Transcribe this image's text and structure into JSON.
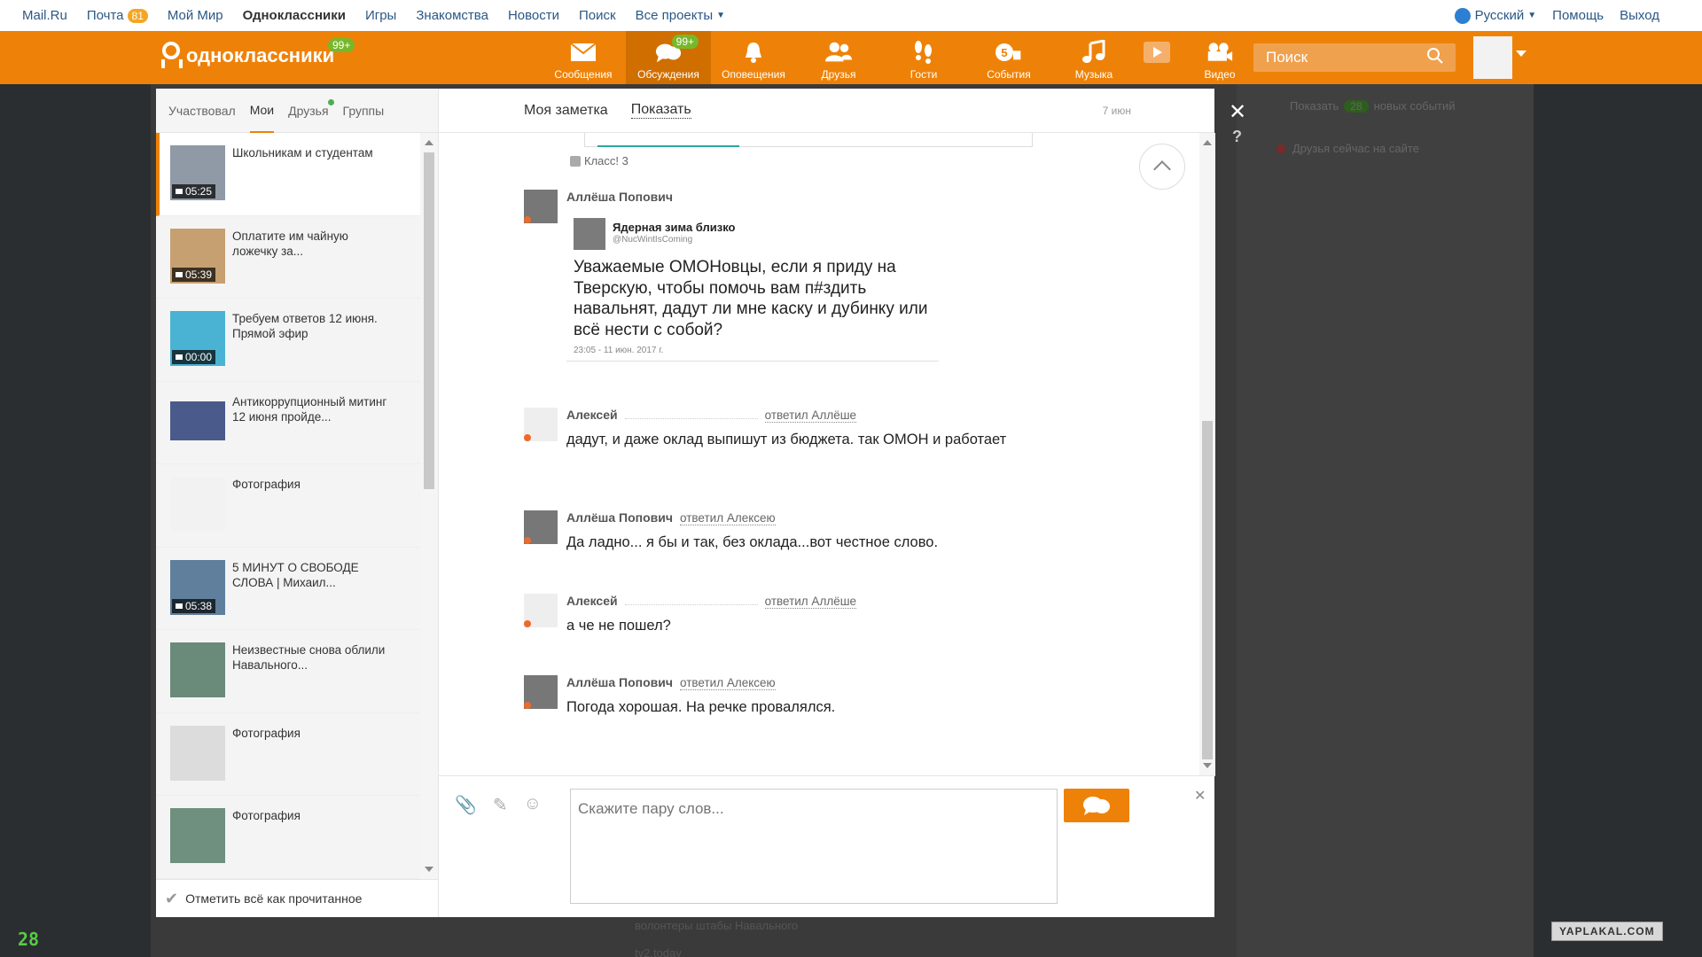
{
  "mailbar": {
    "left_links": [
      {
        "label": "Mail.Ru"
      },
      {
        "label": "Почта",
        "badge": "81"
      },
      {
        "label": "Мой Мир"
      },
      {
        "label": "Одноклассники"
      },
      {
        "label": "Игры"
      },
      {
        "label": "Знакомства"
      },
      {
        "label": "Новости"
      },
      {
        "label": "Поиск"
      },
      {
        "label": "Все проекты"
      }
    ],
    "language": "Русский",
    "help": "Помощь",
    "logout": "Выход"
  },
  "header": {
    "logo_text": "одноклассники",
    "logo_badge": "99+",
    "nav": [
      {
        "label": "Сообщения",
        "icon": "envelope-icon"
      },
      {
        "label": "Обсуждения",
        "icon": "chat-bubbles-icon",
        "badge": "99+",
        "active": true
      },
      {
        "label": "Оповещения",
        "icon": "bell-icon"
      },
      {
        "label": "Друзья",
        "icon": "people-icon"
      },
      {
        "label": "Гости",
        "icon": "footprints-icon"
      },
      {
        "label": "События",
        "icon": "events-icon",
        "badge": "5"
      },
      {
        "label": "Музыка",
        "icon": "music-note-icon"
      },
      {
        "label": "Видео",
        "icon": "video-camera-icon"
      }
    ],
    "search_placeholder": "Поиск"
  },
  "right_column": {
    "show_prefix": "Показать",
    "show_count": "28",
    "show_suffix": "новых событий",
    "friends_online": "Друзья сейчас на сайте"
  },
  "background": {
    "text1": "волонтеры штабы Навального",
    "text2": "tv2.today"
  },
  "watermark": "YAPLAKAL.COM",
  "corner_mark": "28",
  "left_panel": {
    "tabs": [
      "Участвовал",
      "Мои",
      "Друзья",
      "Группы"
    ],
    "active_tab": 1,
    "items": [
      {
        "title": "Школьникам и студентам",
        "duration": "05:25"
      },
      {
        "title": "Оплатите им чайную ложечку за...",
        "duration": "05:39"
      },
      {
        "title": "Требуем ответов 12 июня. Прямой эфир",
        "duration": "00:00"
      },
      {
        "title": "Антикоррупционный митинг 12 июня пройде...",
        "duration": ""
      },
      {
        "title": "Фотография",
        "duration": ""
      },
      {
        "title": "5 МИНУТ О СВОБОДЕ СЛОВА | Михаил...",
        "duration": "05:38"
      },
      {
        "title": "Неизвестные снова облили Навального...",
        "duration": ""
      },
      {
        "title": "Фотография",
        "duration": ""
      },
      {
        "title": "Фотография",
        "duration": ""
      }
    ],
    "mark_all_read": "Отметить всё как прочитанное"
  },
  "conversation": {
    "header_note": "Моя заметка",
    "header_show": "Показать",
    "date": "7 июн",
    "klass": "Класс! 3",
    "messages": [
      {
        "author": "Аллёша Попович",
        "reply_to": "",
        "tweet": {
          "name": "Ядерная зима близко",
          "handle": "@NucWintIsComing",
          "text": "Уважаемые ОМОНовцы, если я приду на Тверскую, чтобы помочь вам п#здить навальнят, дадут ли мне каску и дубинку или всё нести с собой?",
          "date": "23:05 - 11 июн. 2017 г."
        }
      },
      {
        "author": "Алексей",
        "reply_to": "ответил Аллёше",
        "text": "дадут, и даже оклад выпишут из бюджета. так ОМОН и работает"
      },
      {
        "author": "Аллёша Попович",
        "reply_to": "ответил Алексею",
        "text": "Да ладно... я бы и так, без оклада...вот честное слово."
      },
      {
        "author": "Алексей",
        "reply_to": "ответил Аллёше",
        "text": "а че не пошел?"
      },
      {
        "author": "Аллёша Попович",
        "reply_to": "ответил Алексею",
        "text": "Погода хорошая. На речке провалялся."
      }
    ],
    "input_placeholder": "Скажите пару слов..."
  },
  "colors": {
    "brand_orange": "#ee8208",
    "badge_green": "#77b82a",
    "link_blue": "#2a5885"
  }
}
